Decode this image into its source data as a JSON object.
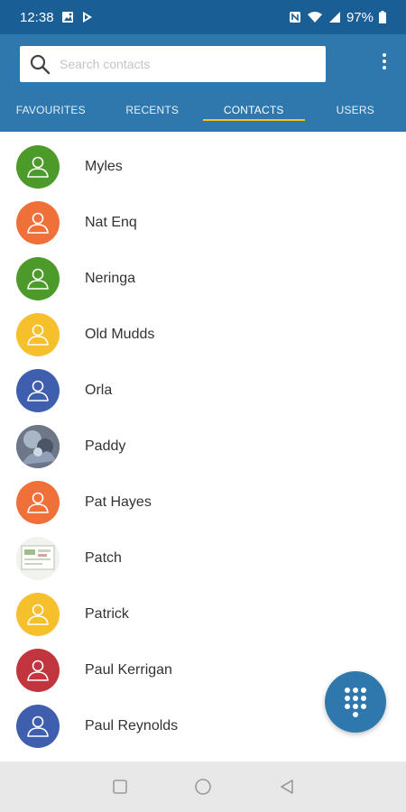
{
  "status_bar": {
    "time": "12:38",
    "battery": "97%"
  },
  "search": {
    "placeholder": "Search contacts"
  },
  "tabs": [
    {
      "label": "FAVOURITES"
    },
    {
      "label": "RECENTS"
    },
    {
      "label": "CONTACTS"
    },
    {
      "label": "USERS"
    }
  ],
  "contacts": [
    {
      "name": "Myles",
      "avatar": "default",
      "color": "#4c9a2a"
    },
    {
      "name": "Nat Enq",
      "avatar": "default",
      "color": "#f0703a"
    },
    {
      "name": "Neringa",
      "avatar": "default",
      "color": "#4c9a2a"
    },
    {
      "name": "Old Mudds",
      "avatar": "default",
      "color": "#f6c02c"
    },
    {
      "name": "Orla",
      "avatar": "default",
      "color": "#3f5fae"
    },
    {
      "name": "Paddy",
      "avatar": "photo",
      "color": "#7a8290"
    },
    {
      "name": "Pat Hayes",
      "avatar": "default",
      "color": "#f0703a"
    },
    {
      "name": "Patch",
      "avatar": "photo",
      "color": "#e8ece4"
    },
    {
      "name": "Patrick",
      "avatar": "default",
      "color": "#f6c02c"
    },
    {
      "name": "Paul Kerrigan",
      "avatar": "default",
      "color": "#c0353e"
    },
    {
      "name": "Paul Reynolds",
      "avatar": "default",
      "color": "#3f5fae"
    }
  ],
  "colors": {
    "status_bar": "#1a5e96",
    "app_bar": "#2f78ad",
    "tab_indicator": "#f5c518",
    "fab": "#2f78ad"
  },
  "icons": {
    "search": "search-icon",
    "overflow": "more-vert-icon",
    "fab": "dialpad-icon",
    "nav": [
      "recents-square-icon",
      "home-circle-icon",
      "back-triangle-icon"
    ]
  }
}
